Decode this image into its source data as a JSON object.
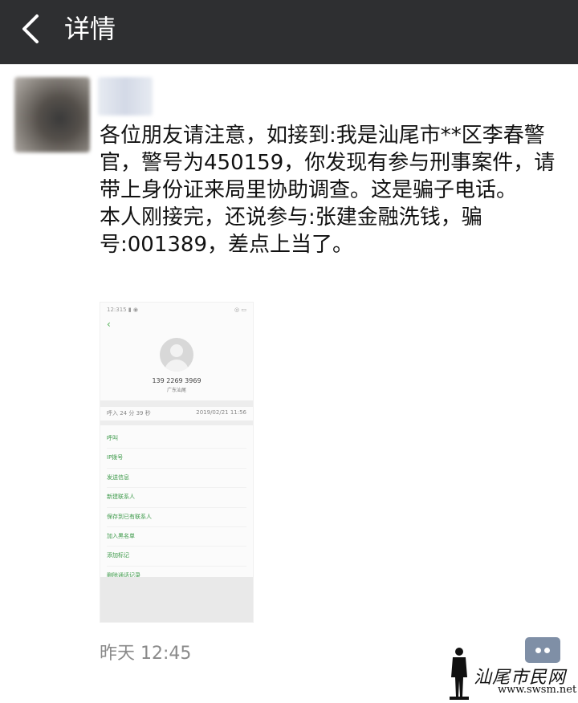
{
  "header": {
    "title": "详情",
    "back_icon": "chevron-left-icon"
  },
  "post": {
    "lines": [
      "各位朋友请注意，如接到:我是汕尾市**区李春警官，警号为450159，你发现有参与刑事案件，请带上身份证来局里协助调查。这是骗子电话。",
      "本人刚接完，还说参与:张建金融洗钱，骗号:001389，差点上当了。"
    ],
    "timestamp": "昨天 12:45",
    "comment_icon": "comment-dots-icon"
  },
  "screenshot": {
    "status_left": "12:315 ▮ ◉",
    "status_right": "◎ ▭",
    "phone_number": "139 2269 3969",
    "sub": "广东汕尾",
    "call_left": "呼入 24 分 39 秒",
    "call_right": "2019/02/21 11:56",
    "menu": [
      "呼叫",
      "IP拨号",
      "发送信息",
      "新建联系人",
      "保存到已有联系人",
      "加入黑名单",
      "添加标记",
      "删除通话记录"
    ]
  },
  "watermark": {
    "text": "汕尾市民网",
    "url": "www.swsm.net"
  }
}
